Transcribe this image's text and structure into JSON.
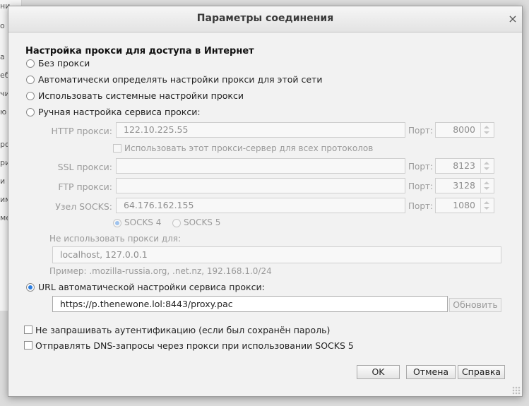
{
  "dialog": {
    "title": "Параметры соединения",
    "close_glyph": "×"
  },
  "proxy": {
    "section_title": "Настройка прокси для доступа в Интернет",
    "options": {
      "no_proxy": "Без прокси",
      "auto_detect": "Автоматически определять настройки прокси для этой сети",
      "system": "Использовать системные настройки прокси",
      "manual": "Ручная настройка сервиса прокси:",
      "auto_url": "URL автоматической настройки сервиса прокси:"
    },
    "selected_option": "auto_url"
  },
  "manual": {
    "port_label": "Порт:",
    "http": {
      "label": "HTTP прокси:",
      "value": "122.10.225.55",
      "port": "8000"
    },
    "use_for_all": {
      "label": "Использовать этот прокси-сервер для всех протоколов",
      "checked": false
    },
    "ssl": {
      "label": "SSL прокси:",
      "value": "",
      "port": "8123"
    },
    "ftp": {
      "label": "FTP прокси:",
      "value": "",
      "port": "3128"
    },
    "socks": {
      "label": "Узел SOCKS:",
      "value": "64.176.162.155",
      "port": "1080"
    },
    "socks_versions": {
      "v4": "SOCKS 4",
      "v5": "SOCKS 5",
      "selected": "v4"
    },
    "no_proxy_for": {
      "label": "Не использовать прокси для:",
      "value": "localhost, 127.0.0.1",
      "example": "Пример: .mozilla-russia.org, .net.nz, 192.168.1.0/24"
    }
  },
  "auto_config": {
    "url": "https://p.thenewone.lol:8443/proxy.pac",
    "reload_button": "Обновить"
  },
  "checkboxes": {
    "no_auth_prompt": {
      "label": "Не запрашивать аутентификацию (если был сохранён пароль)",
      "checked": false
    },
    "socks5_dns": {
      "label": "Отправлять DNS-запросы через прокси при использовании SOCKS 5",
      "checked": false
    }
  },
  "buttons": {
    "ok": "OK",
    "cancel": "Отмена",
    "help": "Справка"
  },
  "background_fragments": [
    "ние",
    "о",
    "а",
    "еб",
    "чи",
    "ю",
    "ро",
    "ри",
    "и",
    "им",
    "ме"
  ],
  "colors": {
    "accent": "#2b7de0",
    "dialog_bg": "#f2f2f2",
    "disabled_text": "#9a9a9a"
  }
}
